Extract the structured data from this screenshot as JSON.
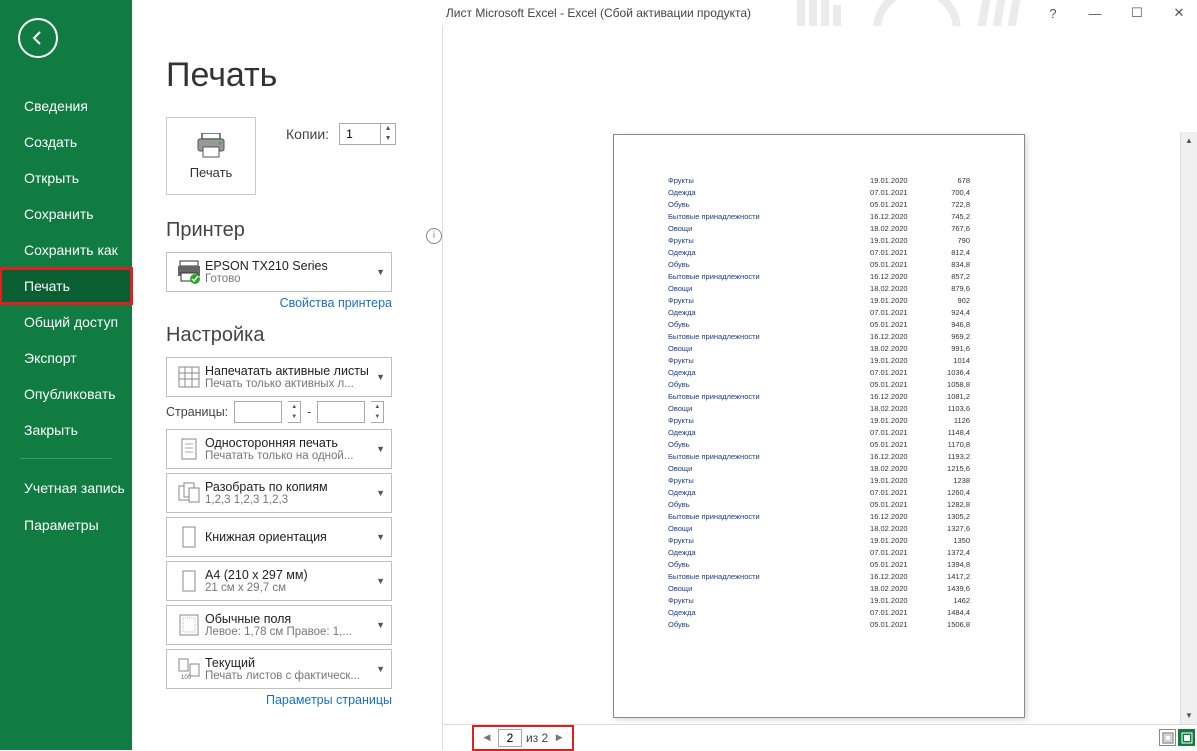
{
  "titlebar": {
    "text": "Лист Microsoft Excel - Excel (Сбой активации продукта)"
  },
  "sidebar": {
    "items": [
      "Сведения",
      "Создать",
      "Открыть",
      "Сохранить",
      "Сохранить как",
      "Печать",
      "Общий доступ",
      "Экспорт",
      "Опубликовать",
      "Закрыть"
    ],
    "account": "Учетная запись",
    "options": "Параметры"
  },
  "page": {
    "title": "Печать",
    "print_button": "Печать",
    "copies_label": "Копии:",
    "copies_value": "1",
    "printer_heading": "Принтер",
    "printer_name": "EPSON TX210 Series",
    "printer_status": "Готово",
    "printer_props": "Свойства принтера",
    "settings_heading": "Настройка",
    "pages_label": "Страницы:",
    "pages_sep": "-",
    "settings": {
      "sheets": {
        "main": "Напечатать активные листы",
        "sub": "Печать только активных л..."
      },
      "duplex": {
        "main": "Односторонняя печать",
        "sub": "Печатать только на одной..."
      },
      "collate": {
        "main": "Разобрать по копиям",
        "sub": "1,2,3    1,2,3    1,2,3"
      },
      "orient": {
        "main": "Книжная ориентация"
      },
      "paper": {
        "main": "A4 (210 x 297 мм)",
        "sub": "21 см x 29,7 см"
      },
      "margins": {
        "main": "Обычные поля",
        "sub": "Левое:  1,78 см   Правое:  1,..."
      },
      "scale": {
        "main": "Текущий",
        "sub": "Печать листов с фактическ..."
      }
    },
    "page_setup": "Параметры страницы"
  },
  "footer": {
    "current_page": "2",
    "page_total": "из 2"
  },
  "preview_rows": [
    [
      "Фрукты",
      "19.01.2020",
      "678"
    ],
    [
      "Одежда",
      "07.01.2021",
      "700,4"
    ],
    [
      "Обувь",
      "05.01.2021",
      "722,8"
    ],
    [
      "Бытовые принадлежности",
      "16.12.2020",
      "745,2"
    ],
    [
      "Овощи",
      "18.02.2020",
      "767,6"
    ],
    [
      "Фрукты",
      "19.01.2020",
      "790"
    ],
    [
      "Одежда",
      "07.01.2021",
      "812,4"
    ],
    [
      "Обувь",
      "05.01.2021",
      "834,8"
    ],
    [
      "Бытовые принадлежности",
      "16.12.2020",
      "857,2"
    ],
    [
      "Овощи",
      "18.02.2020",
      "879,6"
    ],
    [
      "Фрукты",
      "19.01.2020",
      "902"
    ],
    [
      "Одежда",
      "07.01.2021",
      "924,4"
    ],
    [
      "Обувь",
      "05.01.2021",
      "946,8"
    ],
    [
      "Бытовые принадлежности",
      "16.12.2020",
      "969,2"
    ],
    [
      "Овощи",
      "18.02.2020",
      "991,6"
    ],
    [
      "Фрукты",
      "19.01.2020",
      "1014"
    ],
    [
      "Одежда",
      "07.01.2021",
      "1036,4"
    ],
    [
      "Обувь",
      "05.01.2021",
      "1058,8"
    ],
    [
      "Бытовые принадлежности",
      "16.12.2020",
      "1081,2"
    ],
    [
      "Овощи",
      "18.02.2020",
      "1103,6"
    ],
    [
      "Фрукты",
      "19.01.2020",
      "1126"
    ],
    [
      "Одежда",
      "07.01.2021",
      "1148,4"
    ],
    [
      "Обувь",
      "05.01.2021",
      "1170,8"
    ],
    [
      "Бытовые принадлежности",
      "16.12.2020",
      "1193,2"
    ],
    [
      "Овощи",
      "18.02.2020",
      "1215,6"
    ],
    [
      "Фрукты",
      "19.01.2020",
      "1238"
    ],
    [
      "Одежда",
      "07.01.2021",
      "1260,4"
    ],
    [
      "Обувь",
      "05.01.2021",
      "1282,8"
    ],
    [
      "Бытовые принадлежности",
      "16.12.2020",
      "1305,2"
    ],
    [
      "Овощи",
      "18.02.2020",
      "1327,6"
    ],
    [
      "Фрукты",
      "19.01.2020",
      "1350"
    ],
    [
      "Одежда",
      "07.01.2021",
      "1372,4"
    ],
    [
      "Обувь",
      "05.01.2021",
      "1394,8"
    ],
    [
      "Бытовые принадлежности",
      "16.12.2020",
      "1417,2"
    ],
    [
      "Овощи",
      "18.02.2020",
      "1439,6"
    ],
    [
      "Фрукты",
      "19.01.2020",
      "1462"
    ],
    [
      "Одежда",
      "07.01.2021",
      "1484,4"
    ],
    [
      "Обувь",
      "05.01.2021",
      "1506,8"
    ]
  ]
}
